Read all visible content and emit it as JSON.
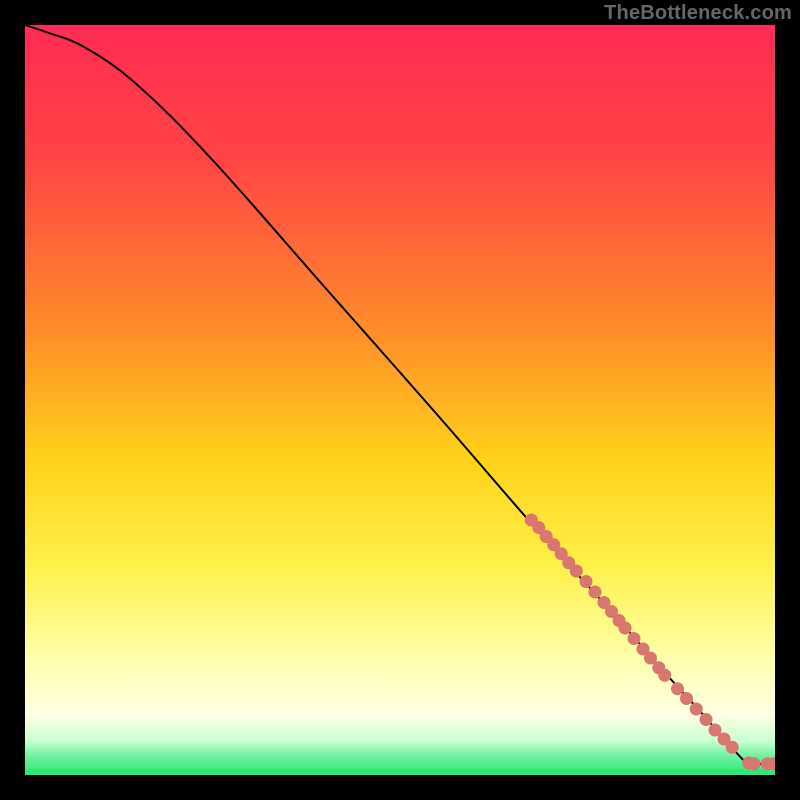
{
  "watermark": "TheBottleneck.com",
  "colors": {
    "bg": "#000000",
    "band_green": "#2ee87a",
    "curve": "#000000",
    "dot": "#d9766f",
    "watermark": "#666666"
  },
  "chart_data": {
    "type": "line",
    "title": "",
    "xlabel": "",
    "ylabel": "",
    "xlim": [
      0,
      100
    ],
    "ylim": [
      0,
      100
    ],
    "grid": false,
    "legend": false,
    "gradient_stops": [
      {
        "offset": 0.0,
        "color": "#ff2b54"
      },
      {
        "offset": 0.18,
        "color": "#ff4545"
      },
      {
        "offset": 0.4,
        "color": "#ff8a2a"
      },
      {
        "offset": 0.58,
        "color": "#ffd21a"
      },
      {
        "offset": 0.72,
        "color": "#fff14a"
      },
      {
        "offset": 0.84,
        "color": "#ffffa8"
      },
      {
        "offset": 0.92,
        "color": "#ffffe6"
      },
      {
        "offset": 0.955,
        "color": "#c8ffd2"
      },
      {
        "offset": 0.975,
        "color": "#6cf2a0"
      },
      {
        "offset": 1.0,
        "color": "#2ee87a"
      }
    ],
    "series": [
      {
        "name": "curve",
        "x": [
          0,
          3,
          8,
          15,
          25,
          40,
          55,
          68,
          78,
          85,
          90,
          93.5,
          96,
          97,
          100
        ],
        "y": [
          100,
          99,
          97,
          92,
          82,
          65,
          48,
          33,
          22,
          14,
          8.5,
          4.5,
          1.8,
          1.5,
          1.5
        ]
      }
    ],
    "dots": [
      {
        "x": 67.5,
        "y": 34.0
      },
      {
        "x": 68.5,
        "y": 33.0
      },
      {
        "x": 69.5,
        "y": 31.8
      },
      {
        "x": 70.5,
        "y": 30.7
      },
      {
        "x": 71.5,
        "y": 29.5
      },
      {
        "x": 72.5,
        "y": 28.3
      },
      {
        "x": 73.5,
        "y": 27.2
      },
      {
        "x": 74.8,
        "y": 25.8
      },
      {
        "x": 76.0,
        "y": 24.4
      },
      {
        "x": 77.2,
        "y": 23.0
      },
      {
        "x": 78.2,
        "y": 21.8
      },
      {
        "x": 79.2,
        "y": 20.6
      },
      {
        "x": 80.0,
        "y": 19.6
      },
      {
        "x": 81.2,
        "y": 18.2
      },
      {
        "x": 82.4,
        "y": 16.8
      },
      {
        "x": 83.4,
        "y": 15.6
      },
      {
        "x": 84.5,
        "y": 14.3
      },
      {
        "x": 85.3,
        "y": 13.3
      },
      {
        "x": 87.0,
        "y": 11.5
      },
      {
        "x": 88.2,
        "y": 10.2
      },
      {
        "x": 89.5,
        "y": 8.8
      },
      {
        "x": 90.8,
        "y": 7.4
      },
      {
        "x": 92.0,
        "y": 6.0
      },
      {
        "x": 93.2,
        "y": 4.8
      },
      {
        "x": 94.3,
        "y": 3.7
      },
      {
        "x": 96.5,
        "y": 1.6
      },
      {
        "x": 97.2,
        "y": 1.5
      },
      {
        "x": 99.0,
        "y": 1.5
      },
      {
        "x": 99.8,
        "y": 1.5
      }
    ]
  }
}
